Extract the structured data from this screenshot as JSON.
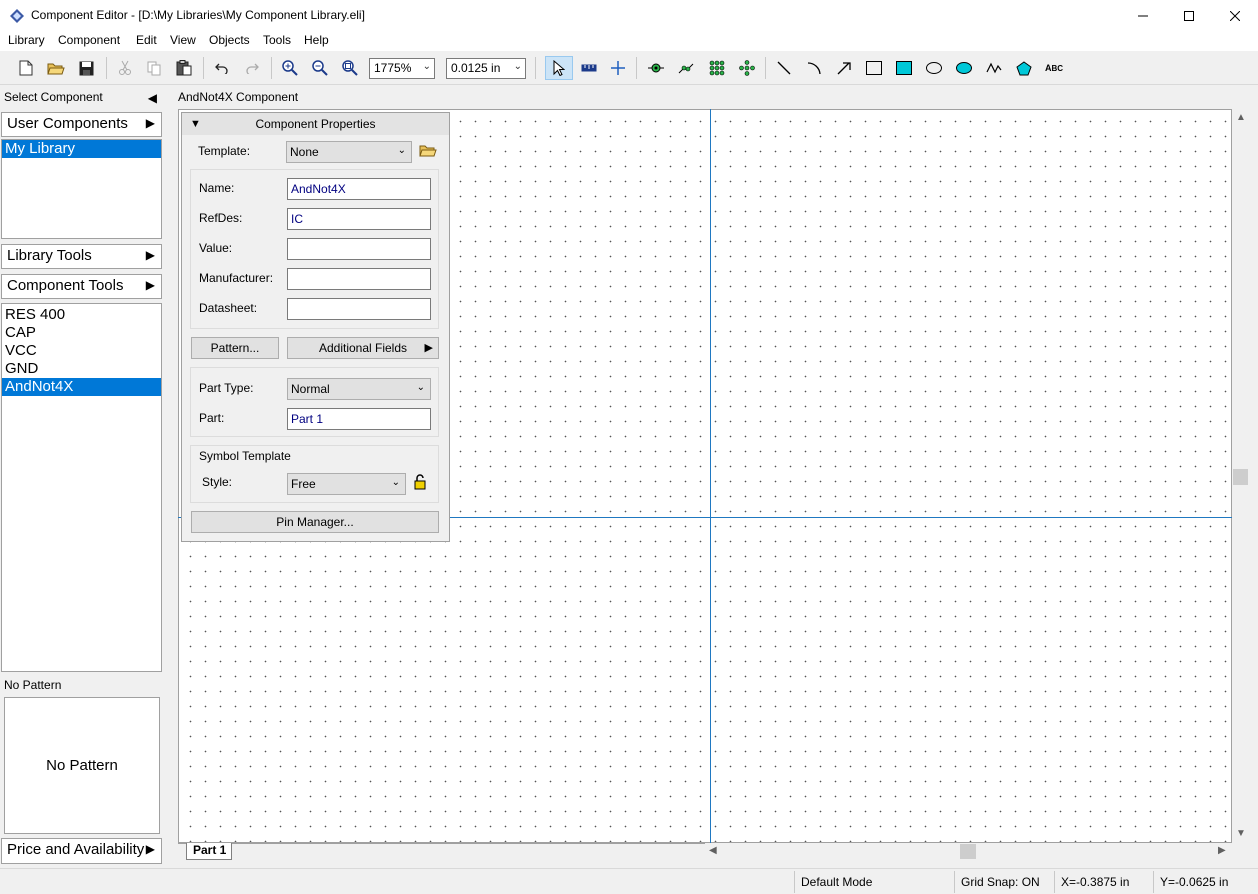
{
  "window": {
    "title": "Component Editor - [D:\\My Libraries\\My Component Library.eli]"
  },
  "menu": [
    "Library",
    "Component",
    "Edit",
    "View",
    "Objects",
    "Tools",
    "Help"
  ],
  "toolbar": {
    "zoom_value": "1775%",
    "grid_value": "0.0125 in"
  },
  "left": {
    "select_component": "Select Component",
    "user_components": "User Components",
    "libraries": [
      {
        "label": "My Library",
        "selected": true
      }
    ],
    "library_tools": "Library Tools",
    "component_tools": "Component Tools",
    "components": [
      {
        "label": "RES 400",
        "selected": false
      },
      {
        "label": "CAP",
        "selected": false
      },
      {
        "label": "VCC",
        "selected": false
      },
      {
        "label": "GND",
        "selected": false
      },
      {
        "label": "AndNot4X",
        "selected": true
      }
    ],
    "pattern_label": "No Pattern",
    "pattern_preview": "No Pattern",
    "price_availability": "Price and Availability"
  },
  "canvas": {
    "title": "AndNot4X Component",
    "tab": "Part 1"
  },
  "props": {
    "header": "Component Properties",
    "template_label": "Template:",
    "template_value": "None",
    "name_label": "Name:",
    "name_value": "AndNot4X",
    "refdes_label": "RefDes:",
    "refdes_value": "IC",
    "value_label": "Value:",
    "value_value": "",
    "manufacturer_label": "Manufacturer:",
    "manufacturer_value": "",
    "datasheet_label": "Datasheet:",
    "datasheet_value": "",
    "pattern_button": "Pattern...",
    "additional_fields_button": "Additional Fields",
    "part_type_label": "Part Type:",
    "part_type_value": "Normal",
    "part_label": "Part:",
    "part_value": "Part 1",
    "symbol_template_label": "Symbol Template",
    "style_label": "Style:",
    "style_value": "Free",
    "pin_manager_button": "Pin Manager..."
  },
  "status": {
    "mode": "Default Mode",
    "grid_snap": "Grid Snap: ON",
    "x": "X=-0.3875 in",
    "y": "Y=-0.0625 in"
  },
  "colors": {
    "selection": "#0078d7",
    "axis": "#1f78c1",
    "input_text": "#000080"
  }
}
